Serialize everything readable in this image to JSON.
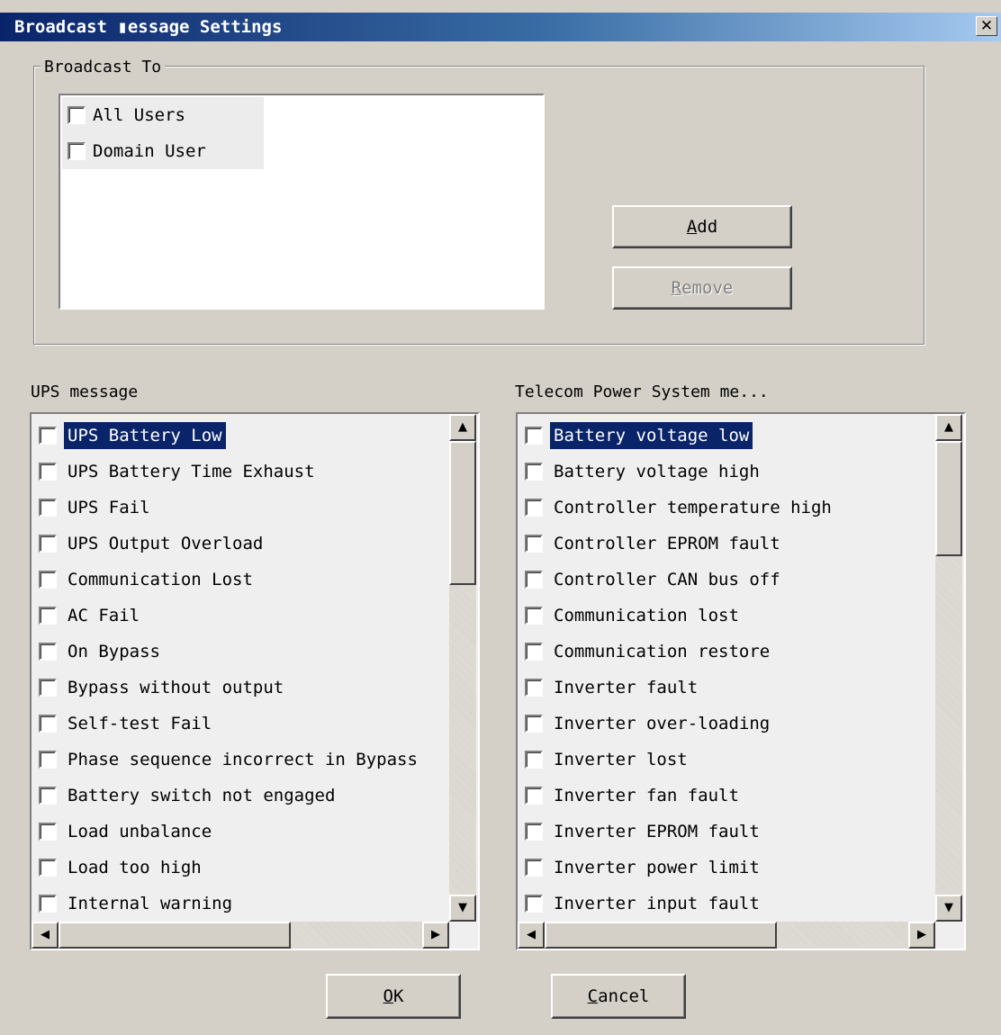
{
  "window": {
    "title": "Broadcast ▮essage Settings",
    "close_glyph": "✕"
  },
  "broadcast": {
    "group_label": "Broadcast To",
    "users": [
      "All Users",
      "Domain User"
    ],
    "add_label": {
      "key": "A",
      "rest": "dd"
    },
    "remove_label": {
      "key": "R",
      "rest": "emove"
    }
  },
  "ups": {
    "label": "UPS message",
    "items": [
      "UPS Battery Low",
      "UPS Battery Time Exhaust",
      "UPS Fail",
      "UPS Output Overload",
      "Communication Lost",
      "AC Fail",
      "On Bypass",
      "Bypass without output",
      "Self-test Fail",
      "Phase sequence incorrect in Bypass",
      "Battery switch not engaged",
      "Load unbalance",
      "Load too high",
      "Internal warning"
    ],
    "selected_index": 0
  },
  "telecom": {
    "label": "Telecom Power System me...",
    "items": [
      "Battery voltage low",
      "Battery voltage high",
      "Controller temperature high",
      "Controller EPROM fault",
      "Controller CAN bus off",
      "Communication lost",
      "Communication restore",
      "Inverter fault",
      "Inverter over-loading",
      "Inverter lost",
      "Inverter fan fault",
      "Inverter EPROM fault",
      "Inverter power limit",
      "Inverter input fault"
    ],
    "selected_index": 0
  },
  "footer": {
    "ok_label": {
      "key": "O",
      "rest": "K"
    },
    "cancel_label": {
      "key": "C",
      "rest": "ancel"
    }
  },
  "icons": {
    "scroll_up": "▲",
    "scroll_down": "▼",
    "scroll_left": "◀",
    "scroll_right": "▶"
  }
}
